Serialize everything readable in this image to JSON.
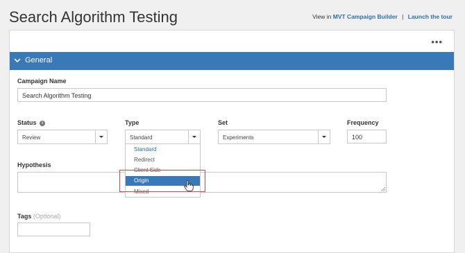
{
  "page": {
    "title": "Search Algorithm Testing",
    "view_in_prefix": "View in",
    "mvt_link": "MVT Campaign Builder",
    "separator": "|",
    "tour_link": "Launch the tour"
  },
  "panel": {
    "more_menu": "•••",
    "section_title": "General"
  },
  "form": {
    "campaign_name": {
      "label": "Campaign Name",
      "value": "Search Algorithm Testing"
    },
    "status": {
      "label": "Status",
      "info_icon": "i",
      "value": "Review"
    },
    "type": {
      "label": "Type",
      "value": "Standard",
      "options": [
        "Standard",
        "Redirect",
        "Client Side",
        "Origin",
        "Mixed"
      ],
      "hovered_option": "Origin"
    },
    "set": {
      "label": "Set",
      "value": "Experiments"
    },
    "frequency": {
      "label": "Frequency",
      "value": "100"
    },
    "hypothesis": {
      "label": "Hypothesis",
      "value": ""
    },
    "tags": {
      "label": "Tags",
      "optional": "(Optional)",
      "value": ""
    }
  },
  "colors": {
    "accent": "#3a79b8",
    "link": "#2b6fad",
    "highlight_box": "#d9453f"
  }
}
